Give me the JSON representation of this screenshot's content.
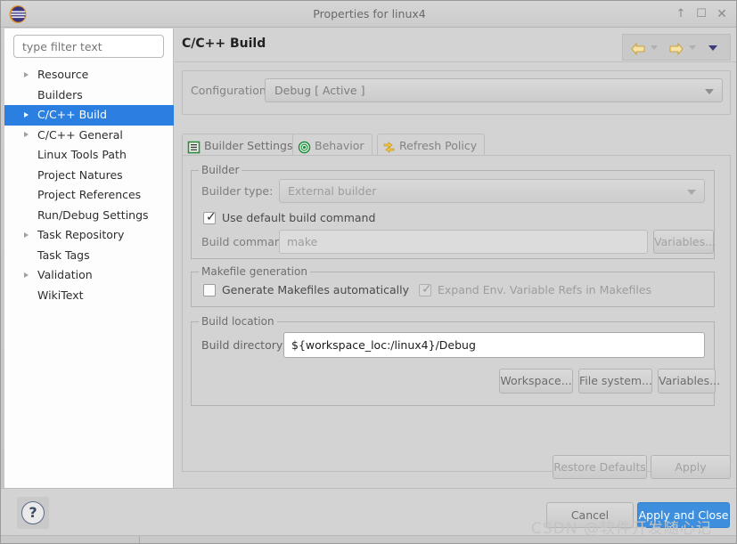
{
  "window": {
    "title": "Properties for linux4",
    "app_icon": "eclipse-logo-icon",
    "minimize_label": "↑",
    "maximize_label": "☐",
    "close_label": "✕"
  },
  "sidebar": {
    "filter_placeholder": "type filter text",
    "filter_value": "",
    "items": [
      {
        "label": "Resource",
        "expandable": true,
        "selected": false
      },
      {
        "label": "Builders",
        "expandable": false,
        "selected": false
      },
      {
        "label": "C/C++ Build",
        "expandable": true,
        "selected": true
      },
      {
        "label": "C/C++ General",
        "expandable": true,
        "selected": false
      },
      {
        "label": "Linux Tools Path",
        "expandable": false,
        "selected": false
      },
      {
        "label": "Project Natures",
        "expandable": false,
        "selected": false
      },
      {
        "label": "Project References",
        "expandable": false,
        "selected": false
      },
      {
        "label": "Run/Debug Settings",
        "expandable": false,
        "selected": false
      },
      {
        "label": "Task Repository",
        "expandable": true,
        "selected": false
      },
      {
        "label": "Task Tags",
        "expandable": false,
        "selected": false
      },
      {
        "label": "Validation",
        "expandable": true,
        "selected": false
      },
      {
        "label": "WikiText",
        "expandable": false,
        "selected": false
      }
    ]
  },
  "main": {
    "page_title": "C/C++ Build",
    "nav": {
      "back_icon": "arrow-left-icon",
      "back_menu_icon": "chevron-down-icon",
      "forward_icon": "arrow-right-icon",
      "forward_menu_icon": "chevron-down-icon",
      "menu_icon": "chevron-down-icon"
    },
    "configuration": {
      "label": "Configuration:",
      "value": "Debug  [ Active ]",
      "caret_icon": "chevron-down-icon"
    },
    "tabs": [
      {
        "label": "Builder Settings",
        "icon": "list-lines-icon",
        "active": true
      },
      {
        "label": "Behavior",
        "icon": "target-radio-icon",
        "active": false
      },
      {
        "label": "Refresh Policy",
        "icon": "refresh-arrows-icon",
        "active": false
      }
    ],
    "builder_group": {
      "title": "Builder",
      "builder_type_label": "Builder type:",
      "builder_type_value": "External builder",
      "use_default_label": "Use default build command",
      "use_default_checked": true,
      "build_command_label": "Build command:",
      "build_command_value": "make",
      "variables_button": "Variables..."
    },
    "makefile_group": {
      "title": "Makefile generation",
      "generate_label": "Generate Makefiles automatically",
      "generate_checked": false,
      "expand_label": "Expand Env. Variable Refs in Makefiles",
      "expand_checked": true
    },
    "location_group": {
      "title": "Build location",
      "build_dir_label": "Build directory:",
      "build_dir_value": "${workspace_loc:/linux4}/Debug",
      "workspace_button": "Workspace...",
      "filesystem_button": "File system...",
      "variables_button": "Variables..."
    },
    "restore_defaults_button": "Restore Defaults",
    "apply_button": "Apply"
  },
  "footer": {
    "help_icon": "question-mark-icon",
    "help_label": "?",
    "cancel_button": "Cancel",
    "apply_close_button": "Apply and Close",
    "watermark": "CSDN @软件开发随心记"
  },
  "colors": {
    "selection_blue": "#2a7fe0",
    "primary_button": "#3d8fdd",
    "window_bg": "#d3d3d3",
    "sidebar_bg": "#fdfdfd"
  }
}
